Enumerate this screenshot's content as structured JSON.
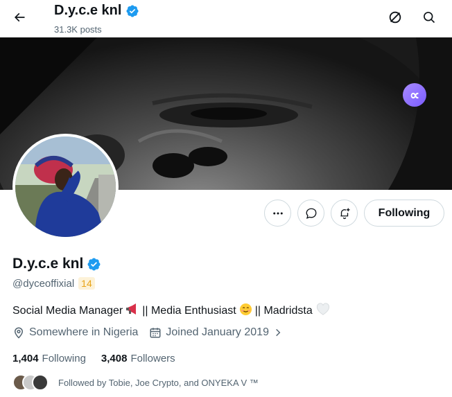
{
  "header": {
    "name": "D.y.c.e knl",
    "posts_count": "31.3K posts"
  },
  "profile": {
    "display_name": "D.y.c.e knl",
    "handle": "@dyceoffixial",
    "badge": "14",
    "bio_part1": "Social Media Manager",
    "bio_part2": "|| Media Enthusiast",
    "bio_part3": "|| Madridsta",
    "location": "Somewhere in Nigeria",
    "joined": "Joined January 2019"
  },
  "stats": {
    "following_count": "1,404",
    "following_label": "Following",
    "followers_count": "3,408",
    "followers_label": "Followers"
  },
  "actions": {
    "following_button": "Following"
  },
  "followed_by": "Followed by Tobie, Joe Crypto, and ONYEKA V ™",
  "colors": {
    "verified": "#1d9bf0",
    "badge_text": "#e8a317",
    "muted": "#536471",
    "grok": "#8b6cff"
  },
  "icons": [
    "back-arrow-icon",
    "verified-icon",
    "grok-icon",
    "search-icon",
    "more-icon",
    "message-icon",
    "notification-bell-icon",
    "location-icon",
    "calendar-icon",
    "chevron-right-icon",
    "megaphone-emoji",
    "smiling-emoji",
    "white-heart-emoji",
    "grok-badge-icon"
  ]
}
